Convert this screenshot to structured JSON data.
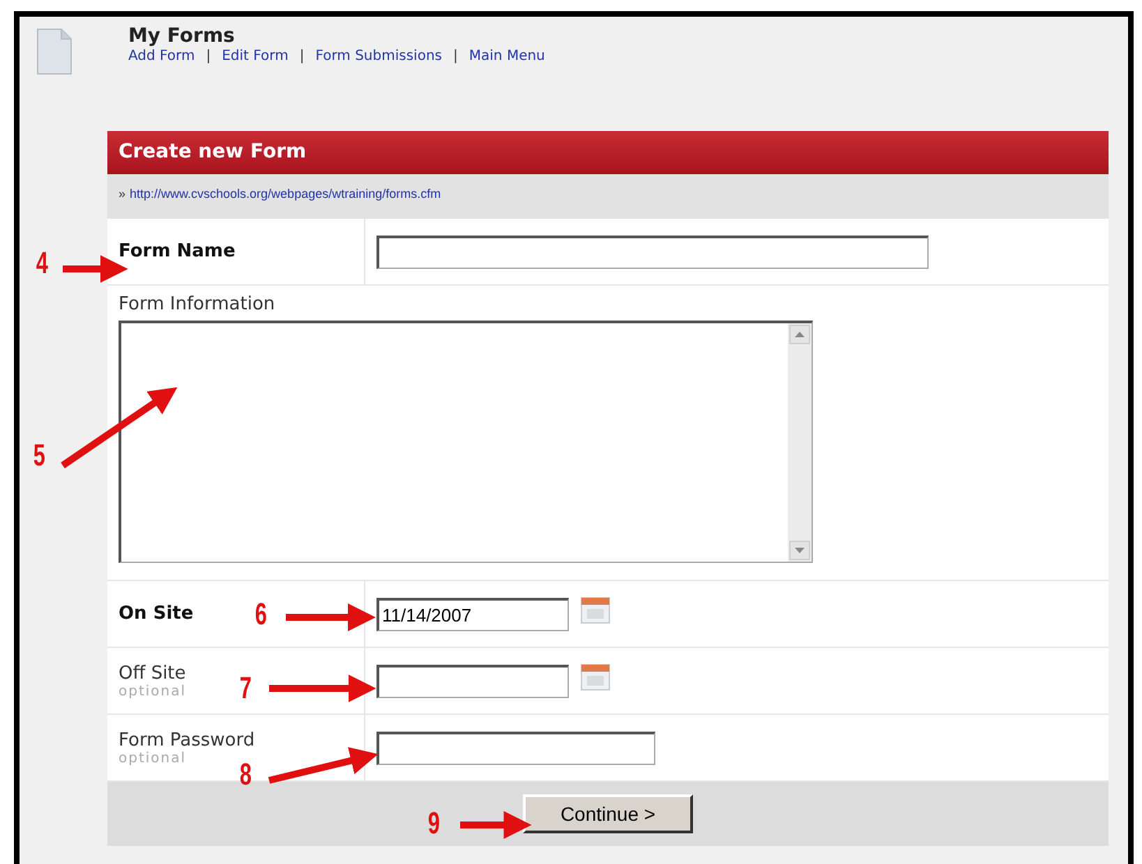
{
  "header": {
    "title": "My Forms",
    "nav": [
      "Add Form",
      "Edit Form",
      "Form Submissions",
      "Main Menu"
    ],
    "separator": "|"
  },
  "panel": {
    "title": "Create new Form",
    "breadcrumb_mark": "»",
    "url": "http://www.cvschools.org/webpages/wtraining/forms.cfm"
  },
  "fields": [
    {
      "kind": "text",
      "label": "Form Name",
      "required": true
    },
    {
      "kind": "textarea",
      "label": "Form Information",
      "required": false
    },
    {
      "kind": "date",
      "label": "On Site",
      "required": true,
      "value": "11/14/2007"
    },
    {
      "kind": "date",
      "label": "Off Site",
      "required": false,
      "note": "optional"
    },
    {
      "kind": "password",
      "label": "Form Password",
      "required": false,
      "note": "optional"
    }
  ],
  "button": "Continue >",
  "callouts": [
    {
      "number": "4"
    },
    {
      "number": "5"
    },
    {
      "number": "6"
    },
    {
      "number": "7"
    },
    {
      "number": "8"
    },
    {
      "number": "9"
    }
  ]
}
